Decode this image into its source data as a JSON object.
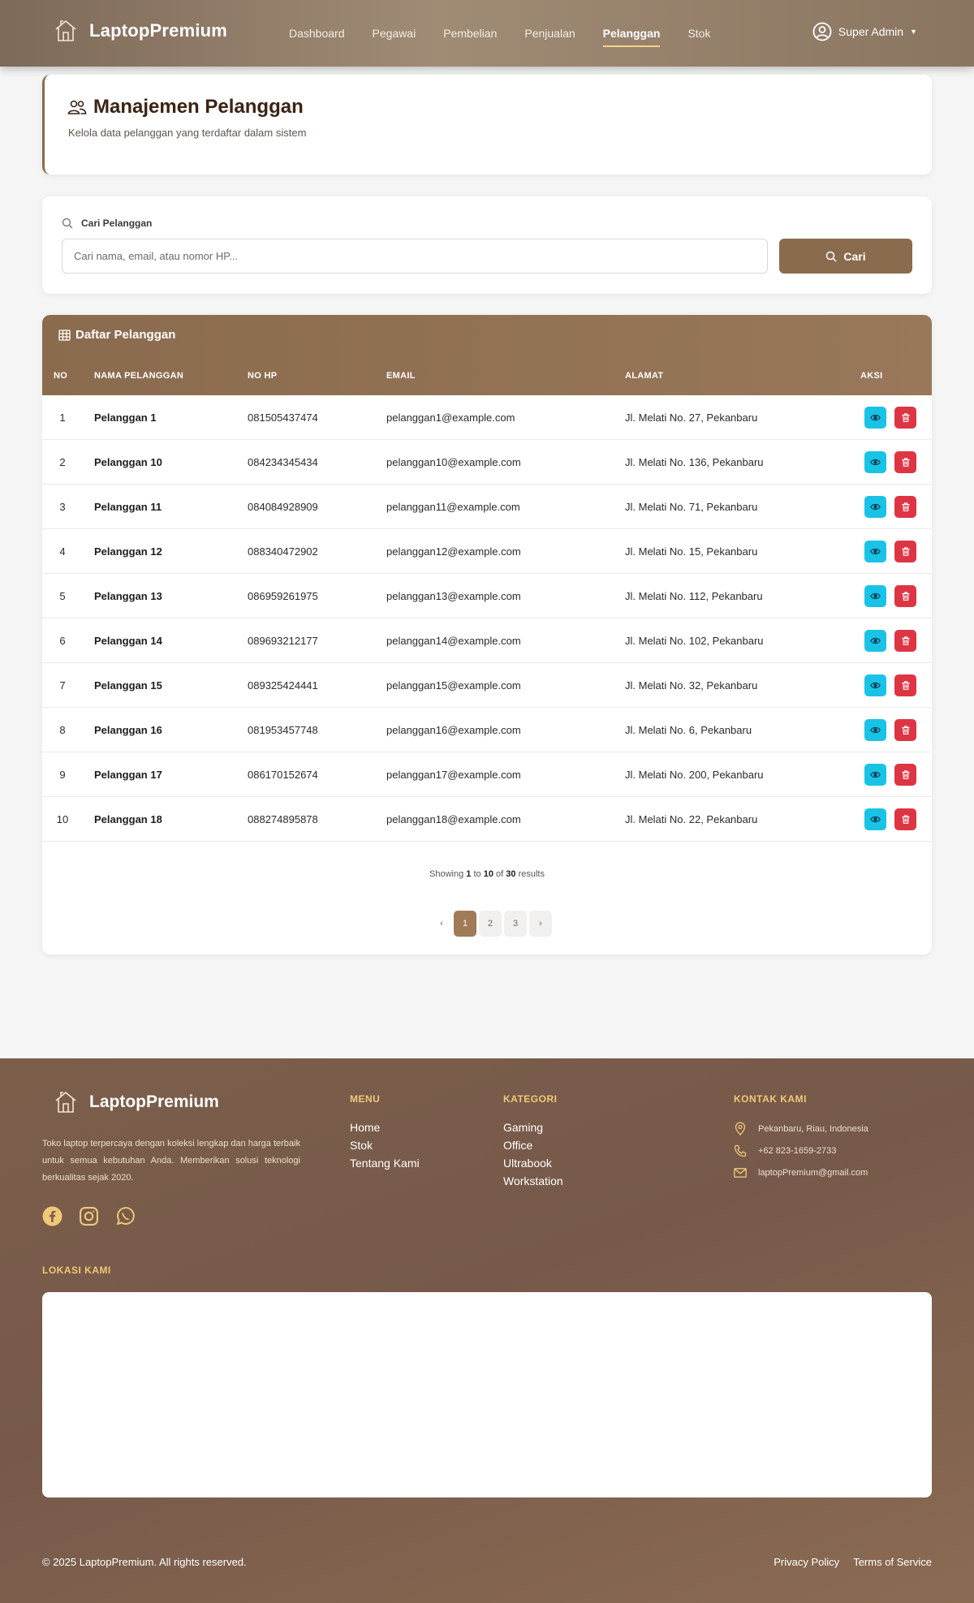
{
  "nav": {
    "brand": "LaptopPremium",
    "links": [
      "Dashboard",
      "Pegawai",
      "Pembelian",
      "Penjualan",
      "Pelanggan",
      "Stok"
    ],
    "active": "Pelanggan",
    "user": "Super Admin"
  },
  "header": {
    "title": "Manajemen Pelanggan",
    "subtitle": "Kelola data pelanggan yang terdaftar dalam sistem"
  },
  "search": {
    "label": "Cari Pelanggan",
    "placeholder": "Cari nama, email, atau nomor HP...",
    "button": "Cari"
  },
  "table": {
    "title": "Daftar Pelanggan",
    "columns": [
      "NO",
      "NAMA PELANGGAN",
      "NO HP",
      "EMAIL",
      "ALAMAT",
      "AKSI"
    ],
    "rows": [
      {
        "no": "1",
        "name": "Pelanggan 1",
        "phone": "081505437474",
        "email": "pelanggan1@example.com",
        "address": "Jl. Melati No. 27, Pekanbaru"
      },
      {
        "no": "2",
        "name": "Pelanggan 10",
        "phone": "084234345434",
        "email": "pelanggan10@example.com",
        "address": "Jl. Melati No. 136, Pekanbaru"
      },
      {
        "no": "3",
        "name": "Pelanggan 11",
        "phone": "084084928909",
        "email": "pelanggan11@example.com",
        "address": "Jl. Melati No. 71, Pekanbaru"
      },
      {
        "no": "4",
        "name": "Pelanggan 12",
        "phone": "088340472902",
        "email": "pelanggan12@example.com",
        "address": "Jl. Melati No. 15, Pekanbaru"
      },
      {
        "no": "5",
        "name": "Pelanggan 13",
        "phone": "086959261975",
        "email": "pelanggan13@example.com",
        "address": "Jl. Melati No. 112, Pekanbaru"
      },
      {
        "no": "6",
        "name": "Pelanggan 14",
        "phone": "089693212177",
        "email": "pelanggan14@example.com",
        "address": "Jl. Melati No. 102, Pekanbaru"
      },
      {
        "no": "7",
        "name": "Pelanggan 15",
        "phone": "089325424441",
        "email": "pelanggan15@example.com",
        "address": "Jl. Melati No. 32, Pekanbaru"
      },
      {
        "no": "8",
        "name": "Pelanggan 16",
        "phone": "081953457748",
        "email": "pelanggan16@example.com",
        "address": "Jl. Melati No. 6, Pekanbaru"
      },
      {
        "no": "9",
        "name": "Pelanggan 17",
        "phone": "086170152674",
        "email": "pelanggan17@example.com",
        "address": "Jl. Melati No. 200, Pekanbaru"
      },
      {
        "no": "10",
        "name": "Pelanggan 18",
        "phone": "088274895878",
        "email": "pelanggan18@example.com",
        "address": "Jl. Melati No. 22, Pekanbaru"
      }
    ],
    "summary": {
      "prefix": "Showing",
      "from": "1",
      "to_word": "to",
      "to": "10",
      "of_word": "of",
      "total": "30",
      "suffix": "results"
    },
    "pagination": {
      "prev": "‹",
      "pages": [
        "1",
        "2",
        "3"
      ],
      "current": "1",
      "next": "›"
    }
  },
  "footer": {
    "brand": "LaptopPremium",
    "description": "Toko laptop terpercaya dengan koleksi lengkap dan harga terbaik untuk semua kebutuhan Anda. Memberikan solusi teknologi berkualitas sejak 2020.",
    "menu_title": "MENU",
    "menu": [
      "Home",
      "Stok",
      "Tentang Kami"
    ],
    "kategori_title": "KATEGORI",
    "kategori": [
      "Gaming",
      "Office",
      "Ultrabook",
      "Workstation"
    ],
    "kontak_title": "KONTAK KAMI",
    "address": "Pekanbaru, Riau, Indonesia",
    "phone": "+62 823-1659-2733",
    "email": "laptopPremium@gmail.com",
    "lokasi_title": "LOKASI KAMI",
    "copyright": "© 2025 LaptopPremium. All rights reserved.",
    "privacy": "Privacy Policy",
    "terms": "Terms of Service"
  },
  "colors": {
    "brand": "#8b6b4e",
    "accent_gold": "#f0c878",
    "view_button": "#19c3e6",
    "delete_button": "#de3545"
  },
  "icons": [
    "house-logo-icon",
    "user-circle-icon",
    "users-icon",
    "search-icon",
    "table-icon",
    "eye-icon",
    "trash-icon",
    "facebook-icon",
    "instagram-icon",
    "whatsapp-icon",
    "map-pin-icon",
    "phone-icon",
    "mail-icon"
  ]
}
